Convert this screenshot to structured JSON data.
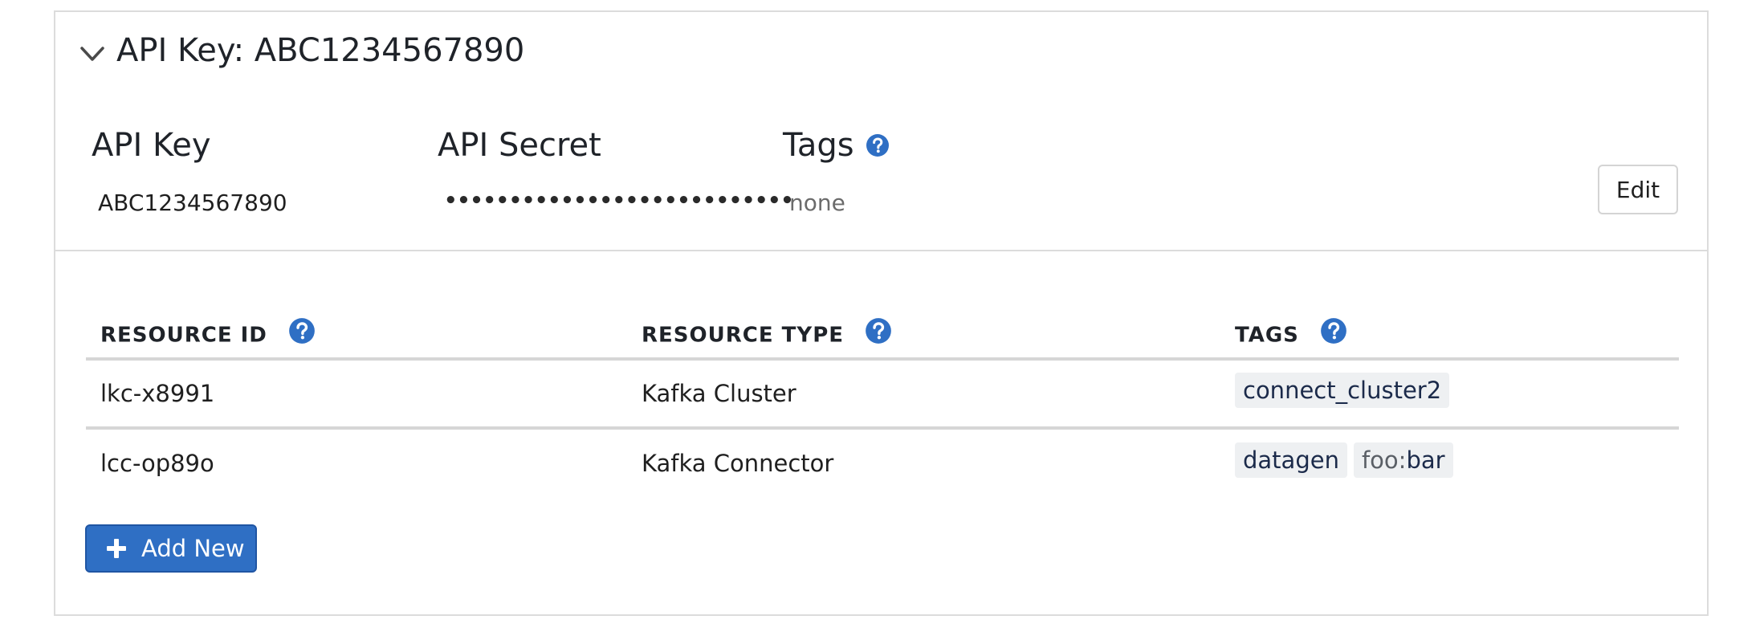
{
  "panel": {
    "title": "API Key: ABC1234567890",
    "icons": {
      "collapse": "chevron-down-icon",
      "help": "question-circle-icon"
    }
  },
  "credentials": {
    "api_key_label": "API Key",
    "api_key_value": "ABC1234567890",
    "api_secret_label": "API Secret",
    "api_secret_value": "•••••••••••••••••••••••••••",
    "tags_label": "Tags",
    "tags_value": "none",
    "edit_label": "Edit"
  },
  "table": {
    "headers": {
      "resource_id": "RESOURCE ID",
      "resource_type": "RESOURCE TYPE",
      "tags": "TAGS"
    },
    "rows": [
      {
        "resource_id": "lkc-x8991",
        "resource_type": "Kafka Cluster",
        "tags": [
          {
            "key": "",
            "value": "connect_cluster2"
          }
        ]
      },
      {
        "resource_id": "lcc-op89o",
        "resource_type": "Kafka Connector",
        "tags": [
          {
            "key": "",
            "value": "datagen"
          },
          {
            "key": "foo",
            "separator": ":",
            "value": "bar"
          }
        ]
      }
    ]
  },
  "actions": {
    "add_new_label": "Add New",
    "add_new_icon": "plus-icon"
  },
  "colors": {
    "primary": "#2f6fc4",
    "help_icon": "#2f6fc4",
    "border": "#dcdcdc",
    "chip_bg": "#eef0f2"
  }
}
